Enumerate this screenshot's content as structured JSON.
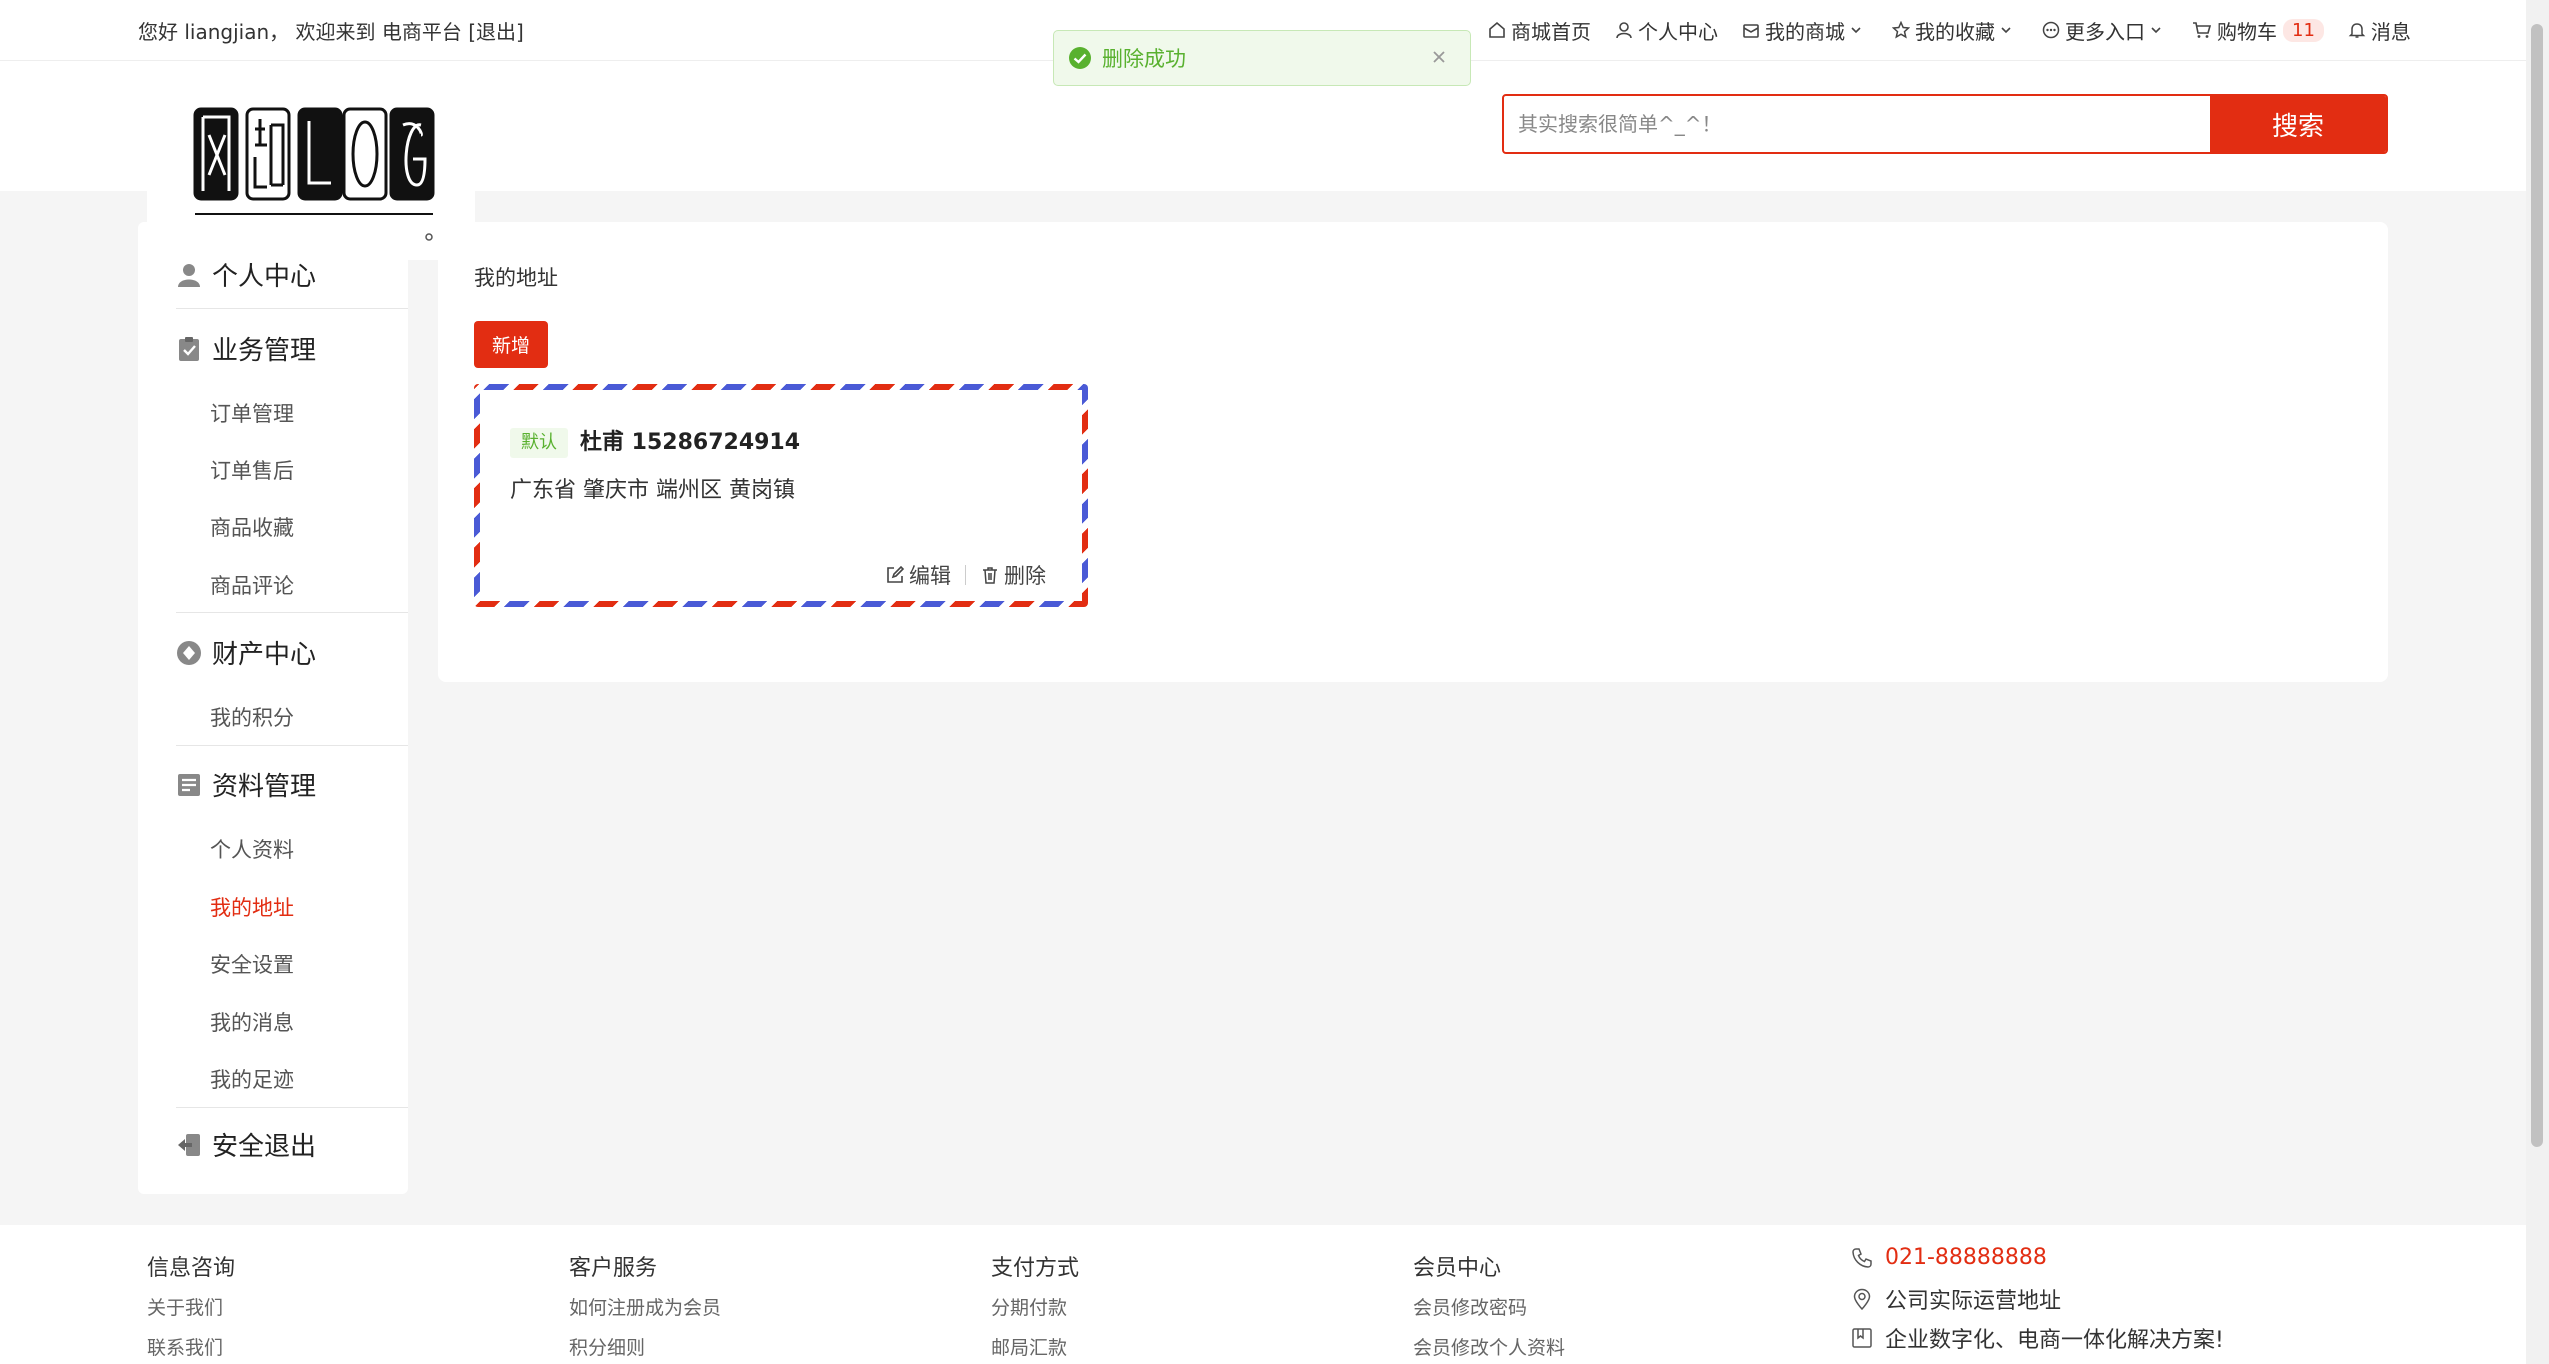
{
  "topbar": {
    "welcome": "您好 liangjian， 欢迎来到 电商平台 [退出]",
    "nav": {
      "home": "商城首页",
      "profile": "个人中心",
      "my_shop": "我的商城",
      "favorites": "我的收藏",
      "more": "更多入口",
      "cart": "购物车",
      "cart_count": "11",
      "messages": "消息"
    }
  },
  "toast": {
    "text": "删除成功",
    "type": "success"
  },
  "header": {
    "logo_text": "网站LOG",
    "search": {
      "placeholder": "其实搜索很简单^_^！",
      "value": "",
      "button": "搜索"
    }
  },
  "sidebar": {
    "sections": [
      {
        "title": "个人中心",
        "icon": "user-icon",
        "items": []
      },
      {
        "title": "业务管理",
        "icon": "clipboard-icon",
        "items": [
          "订单管理",
          "订单售后",
          "商品收藏",
          "商品评论"
        ]
      },
      {
        "title": "财产中心",
        "icon": "asset-icon",
        "items": [
          "我的积分"
        ]
      },
      {
        "title": "资料管理",
        "icon": "document-icon",
        "items": [
          "个人资料",
          "我的地址",
          "安全设置",
          "我的消息",
          "我的足迹"
        ]
      },
      {
        "title": "安全退出",
        "icon": "logout-icon",
        "items": []
      }
    ],
    "active_item": "我的地址"
  },
  "main": {
    "title": "我的地址",
    "add_button": "新增",
    "addresses": [
      {
        "tag": "默认",
        "name_phone": "杜甫 15286724914",
        "region": "广东省 肇庆市 端州区 黄岗镇",
        "edit": "编辑",
        "delete": "删除"
      }
    ]
  },
  "footer": {
    "columns": [
      {
        "title": "信息咨询",
        "links": [
          "关于我们",
          "联系我们"
        ]
      },
      {
        "title": "客户服务",
        "links": [
          "如何注册成为会员",
          "积分细则"
        ]
      },
      {
        "title": "支付方式",
        "links": [
          "分期付款",
          "邮局汇款"
        ]
      },
      {
        "title": "会员中心",
        "links": [
          "会员修改密码",
          "会员修改个人资料"
        ]
      }
    ],
    "contact": {
      "phone": "021-88888888",
      "address": "公司实际运营地址",
      "slogan": "企业数字化、电商一体化解决方案!"
    }
  },
  "colors": {
    "accent": "#e22d12",
    "success": "#59b12f",
    "stripe_blue": "#4a5ad6"
  }
}
